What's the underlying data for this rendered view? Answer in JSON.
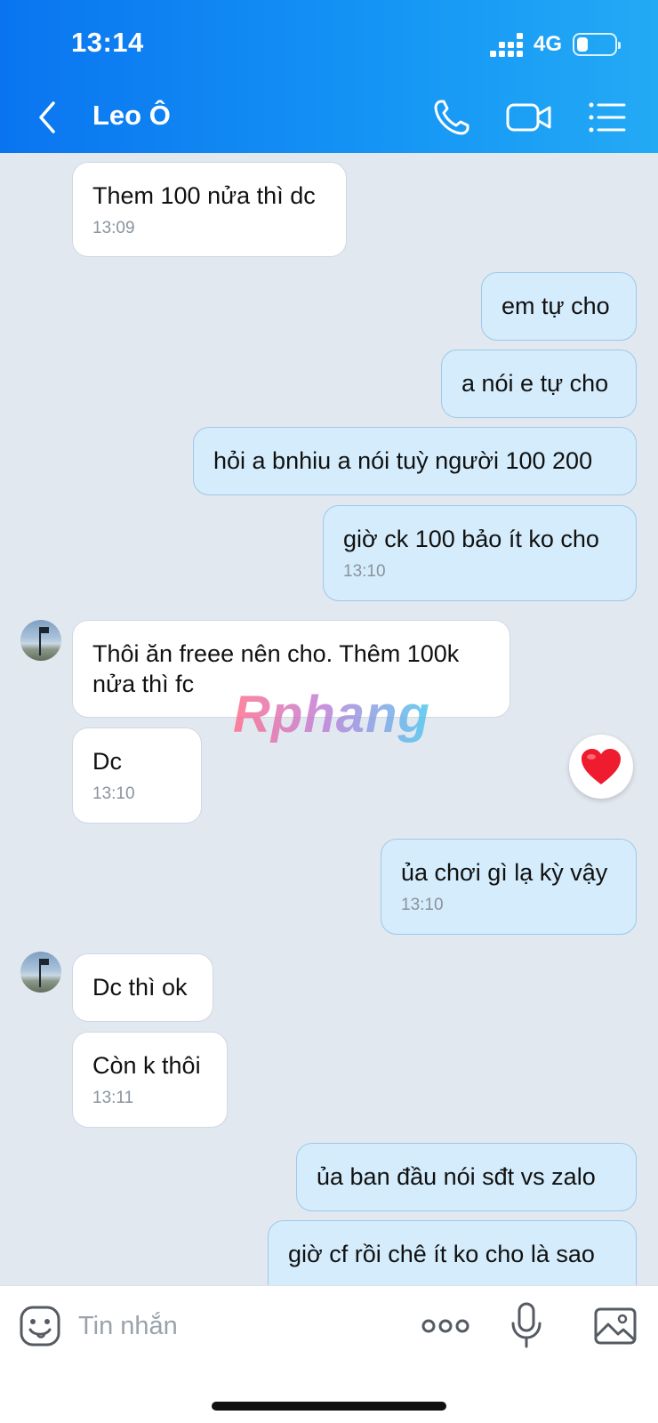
{
  "status_bar": {
    "time": "13:14",
    "network": "4G",
    "battery_level": 0.3
  },
  "header": {
    "contact_name": "Leo Ô",
    "accent_color": "#0a74f0",
    "icons": [
      "back-icon",
      "phone-icon",
      "video-icon",
      "menu-list-icon"
    ]
  },
  "messages": [
    {
      "side": "in",
      "text": "Them 100 nửa thì dc",
      "time": "13:09"
    },
    {
      "side": "out",
      "text": "em tự cho"
    },
    {
      "side": "out",
      "text": "a nói e tự cho"
    },
    {
      "side": "out",
      "text": "hỏi a bnhiu a nói tuỳ người 100 200"
    },
    {
      "side": "out",
      "text": "giờ ck 100 bảo ít ko cho",
      "time": "13:10"
    },
    {
      "side": "in",
      "text_lines": [
        "Thôi ăn freee nên cho. Thêm 100k",
        "nửa thì fc"
      ]
    },
    {
      "side": "in",
      "text": "Dc",
      "time": "13:10",
      "reaction": "heart-icon"
    },
    {
      "side": "out",
      "text": "ủa chơi gì lạ kỳ vậy",
      "time": "13:10"
    },
    {
      "side": "in",
      "text": "Dc thì ok"
    },
    {
      "side": "in",
      "text": "Còn k thôi",
      "time": "13:11"
    },
    {
      "side": "out",
      "text": "ủa ban đầu nói sđt vs zalo"
    },
    {
      "side": "out",
      "text": "giờ cf rồi chê ít ko cho là sao"
    }
  ],
  "watermark": "Rphang",
  "composer": {
    "placeholder": "Tin nhắn",
    "icons": [
      "emoji-icon",
      "more-dots-icon",
      "microphone-icon",
      "image-icon"
    ]
  }
}
